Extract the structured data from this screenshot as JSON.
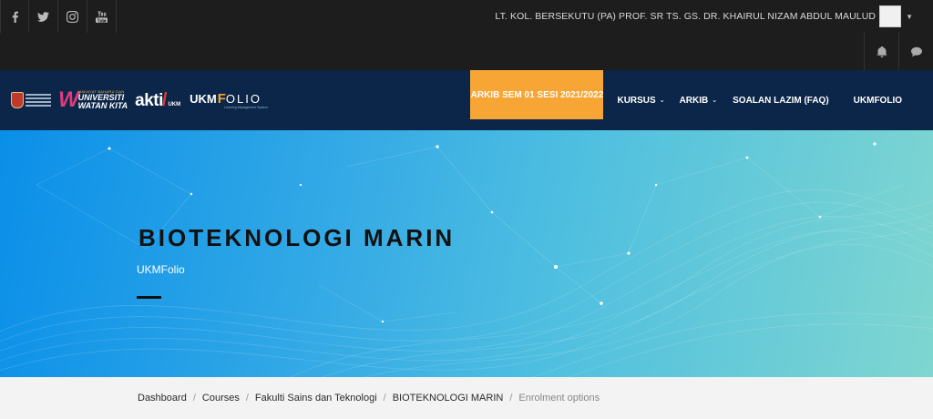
{
  "topbar": {
    "social": [
      {
        "icon": "facebook-icon"
      },
      {
        "icon": "twitter-icon"
      },
      {
        "icon": "instagram-icon"
      },
      {
        "icon": "youtube-icon"
      }
    ],
    "user_name": "LT. KOL. BERSEKUTU (PA) PROF. SR TS. GS. DR. KHAIRUL NIZAM ABDUL MAULUD",
    "tools": [
      "bell-icon",
      "chat-icon"
    ]
  },
  "logos": {
    "uwk_small": "MAKAYAT BAHARU DAN",
    "uwk_line1": "UNIVERSITI",
    "uwk_line2": "WATAN KITA",
    "uwk_w": "W",
    "akti": "akti",
    "akti_slash": "/",
    "akti_ukm": "UKM",
    "folio_ukm": "UKM",
    "folio_f": "F",
    "folio_rest": "OLIO",
    "folio_sub": "Learning Management System"
  },
  "menu": {
    "arkib_sem": "ARKIB SEM 01 SESI 2021/2022",
    "kursus": "KURSUS",
    "arkib": "ARKIB",
    "faq": "SOALAN LAZIM (FAQ)",
    "ukmfolio": "UKMFOLIO"
  },
  "hero": {
    "title": "BIOTEKNOLOGI MARIN",
    "subtitle": "UKMFolio"
  },
  "breadcrumb": {
    "items": [
      "Dashboard",
      "Courses",
      "Fakulti Sains dan Teknologi",
      "BIOTEKNOLOGI MARIN"
    ],
    "current": "Enrolment options",
    "separator": "/"
  },
  "colors": {
    "topbar": "#1d1d1d",
    "navbar": "#0b2648",
    "accent": "#f7a535"
  }
}
